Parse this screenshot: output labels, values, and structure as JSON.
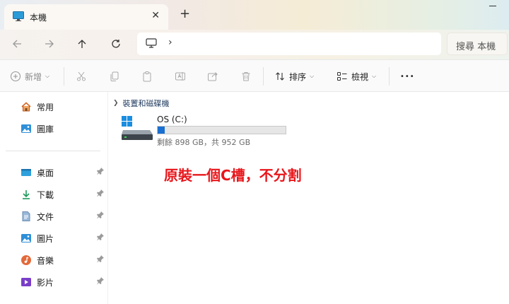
{
  "tab": {
    "title": "本機",
    "close": "✕"
  },
  "new_tab": "+",
  "address": {
    "chevron": "›"
  },
  "search": {
    "placeholder": "搜尋 本機"
  },
  "commandbar": {
    "new_label": "新增",
    "sort_label": "排序",
    "view_label": "檢視",
    "more": "•••"
  },
  "sidebar": {
    "top_items": [
      {
        "label": "常用",
        "icon": "home-icon"
      },
      {
        "label": "圖庫",
        "icon": "gallery-icon"
      }
    ],
    "pinned_items": [
      {
        "label": "桌面",
        "icon": "desktop-folder-icon"
      },
      {
        "label": "下載",
        "icon": "download-icon"
      },
      {
        "label": "文件",
        "icon": "documents-icon"
      },
      {
        "label": "圖片",
        "icon": "pictures-icon"
      },
      {
        "label": "音樂",
        "icon": "music-icon"
      },
      {
        "label": "影片",
        "icon": "videos-icon"
      }
    ]
  },
  "content": {
    "group_title": "裝置和磁碟機",
    "drive": {
      "name": "OS (C:)",
      "info": "剩餘 898 GB，共 952 GB",
      "used_fraction": 0.057,
      "bar_color": "#1a6fd1"
    }
  },
  "annotation": "原裝一個C槽，不分割"
}
